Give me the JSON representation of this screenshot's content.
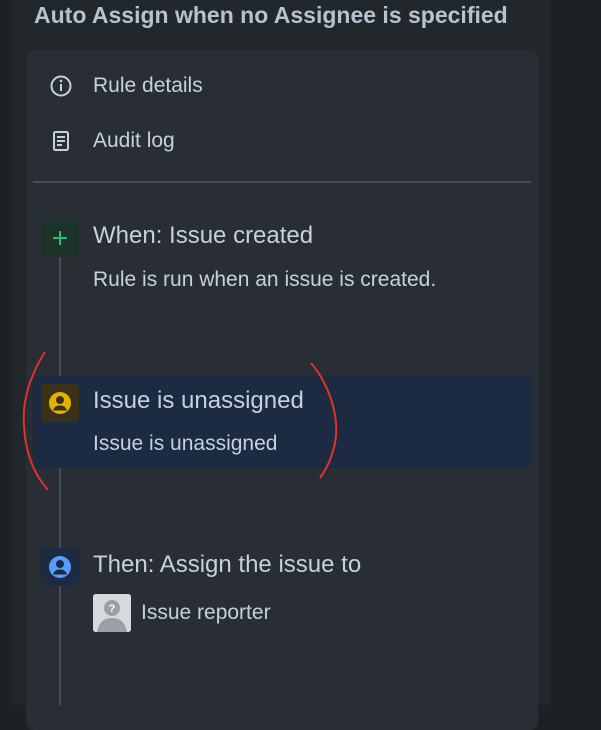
{
  "rule": {
    "title": "Auto Assign when no Assignee is specified"
  },
  "menu": {
    "items": [
      {
        "label": "Rule details",
        "icon": "info-icon"
      },
      {
        "label": "Audit log",
        "icon": "audit-log-icon"
      }
    ]
  },
  "steps": [
    {
      "title": "When: Issue created",
      "description": "Rule is run when an issue is created.",
      "icon": "plus-icon",
      "color": "#2abb7f"
    },
    {
      "title": "Issue is unassigned",
      "description": "Issue is unassigned",
      "icon": "user-condition-icon",
      "color": "#e2b203",
      "selected": true
    },
    {
      "title": "Then: Assign the issue to",
      "assignee": "Issue reporter",
      "icon": "user-action-icon",
      "color": "#579dff"
    }
  ],
  "colors": {
    "background": "#1d2125",
    "panel": "#22272b",
    "card": "#282e33",
    "selected": "#1c2b41",
    "annotation": "#e0322f"
  }
}
